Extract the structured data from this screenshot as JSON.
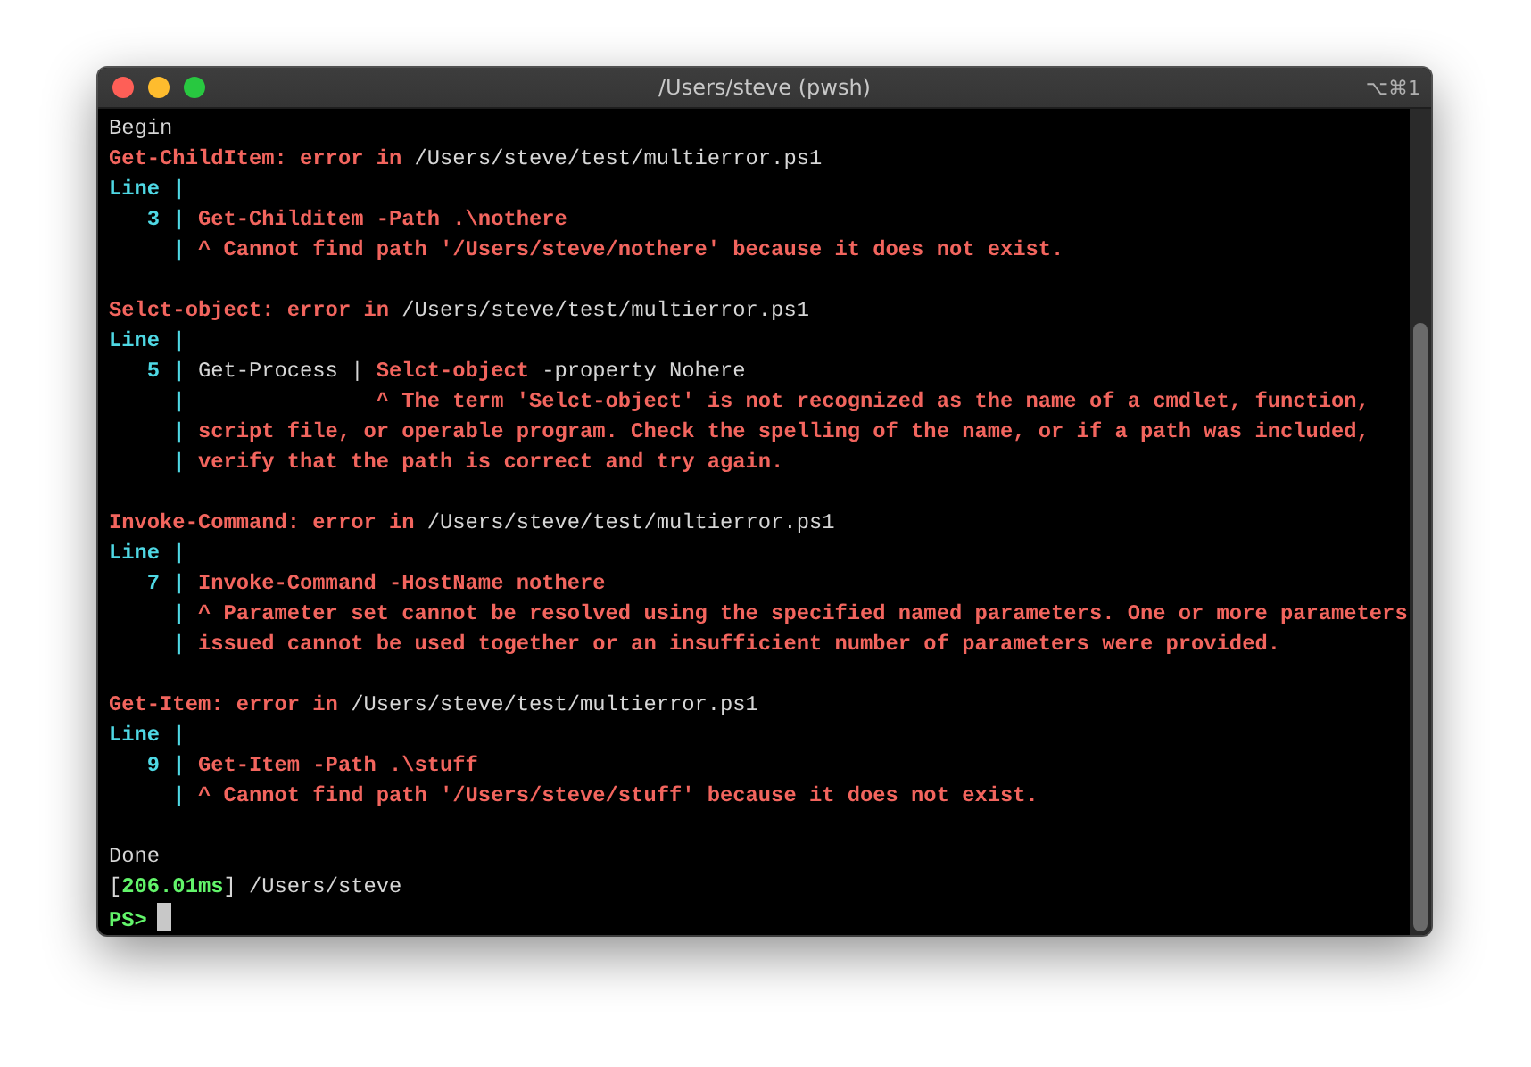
{
  "window": {
    "title": "/Users/steve (pwsh)",
    "shortcut": "⌥⌘1"
  },
  "terminal": {
    "lines": [
      {
        "kind": "text",
        "segments": [
          {
            "kind": "output",
            "text": "Begin"
          }
        ]
      },
      {
        "kind": "text",
        "segments": [
          {
            "kind": "error",
            "text": "Get-ChildItem: error in "
          },
          {
            "kind": "path",
            "text": "/Users/steve/test/multierror.ps1"
          }
        ]
      },
      {
        "kind": "text",
        "segments": [
          {
            "kind": "gutter",
            "text": "Line |"
          }
        ]
      },
      {
        "kind": "text",
        "segments": [
          {
            "kind": "gutter",
            "text": "   3 | "
          },
          {
            "kind": "error",
            "text": "Get-Childitem -Path .\\nothere"
          }
        ]
      },
      {
        "kind": "text",
        "segments": [
          {
            "kind": "gutter",
            "text": "     | "
          },
          {
            "kind": "error",
            "text": "^ Cannot find path '/Users/steve/nothere' because it does not exist."
          }
        ]
      },
      {
        "kind": "blank"
      },
      {
        "kind": "text",
        "segments": [
          {
            "kind": "error",
            "text": "Selct-object: error in "
          },
          {
            "kind": "path",
            "text": "/Users/steve/test/multierror.ps1"
          }
        ]
      },
      {
        "kind": "text",
        "segments": [
          {
            "kind": "gutter",
            "text": "Line |"
          }
        ]
      },
      {
        "kind": "text",
        "segments": [
          {
            "kind": "gutter",
            "text": "   5 | "
          },
          {
            "kind": "code",
            "text": "Get-Process | "
          },
          {
            "kind": "error",
            "text": "Selct-object"
          },
          {
            "kind": "code",
            "text": " -property Nohere"
          }
        ]
      },
      {
        "kind": "text",
        "segments": [
          {
            "kind": "gutter",
            "text": "     | "
          },
          {
            "kind": "error",
            "text": "              ^ The term 'Selct-object' is not recognized as the name of a cmdlet, function,"
          }
        ]
      },
      {
        "kind": "text",
        "segments": [
          {
            "kind": "gutter",
            "text": "     | "
          },
          {
            "kind": "error",
            "text": "script file, or operable program. Check the spelling of the name, or if a path was included,"
          }
        ]
      },
      {
        "kind": "text",
        "segments": [
          {
            "kind": "gutter",
            "text": "     | "
          },
          {
            "kind": "error",
            "text": "verify that the path is correct and try again."
          }
        ]
      },
      {
        "kind": "blank"
      },
      {
        "kind": "text",
        "segments": [
          {
            "kind": "error",
            "text": "Invoke-Command: error in "
          },
          {
            "kind": "path",
            "text": "/Users/steve/test/multierror.ps1"
          }
        ]
      },
      {
        "kind": "text",
        "segments": [
          {
            "kind": "gutter",
            "text": "Line |"
          }
        ]
      },
      {
        "kind": "text",
        "segments": [
          {
            "kind": "gutter",
            "text": "   7 | "
          },
          {
            "kind": "error",
            "text": "Invoke-Command -HostName nothere"
          }
        ]
      },
      {
        "kind": "text",
        "segments": [
          {
            "kind": "gutter",
            "text": "     | "
          },
          {
            "kind": "error",
            "text": "^ Parameter set cannot be resolved using the specified named parameters. One or more parameters"
          }
        ]
      },
      {
        "kind": "text",
        "segments": [
          {
            "kind": "gutter",
            "text": "     | "
          },
          {
            "kind": "error",
            "text": "issued cannot be used together or an insufficient number of parameters were provided."
          }
        ]
      },
      {
        "kind": "blank"
      },
      {
        "kind": "text",
        "segments": [
          {
            "kind": "error",
            "text": "Get-Item: error in "
          },
          {
            "kind": "path",
            "text": "/Users/steve/test/multierror.ps1"
          }
        ]
      },
      {
        "kind": "text",
        "segments": [
          {
            "kind": "gutter",
            "text": "Line |"
          }
        ]
      },
      {
        "kind": "text",
        "segments": [
          {
            "kind": "gutter",
            "text": "   9 | "
          },
          {
            "kind": "error",
            "text": "Get-Item -Path .\\stuff"
          }
        ]
      },
      {
        "kind": "text",
        "segments": [
          {
            "kind": "gutter",
            "text": "     | "
          },
          {
            "kind": "error",
            "text": "^ Cannot find path '/Users/steve/stuff' because it does not exist."
          }
        ]
      },
      {
        "kind": "blank"
      },
      {
        "kind": "text",
        "segments": [
          {
            "kind": "output",
            "text": "Done"
          }
        ]
      },
      {
        "kind": "text",
        "segments": [
          {
            "kind": "output",
            "text": "["
          },
          {
            "kind": "timing",
            "text": "206.01ms"
          },
          {
            "kind": "output",
            "text": "] /Users/steve"
          }
        ]
      },
      {
        "kind": "prompt",
        "segments": [
          {
            "kind": "timing",
            "text": "PS>"
          }
        ]
      }
    ]
  }
}
